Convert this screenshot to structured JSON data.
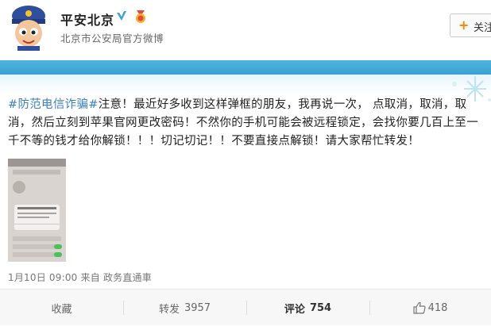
{
  "account": {
    "name": "平安北京",
    "subtitle": "北京市公安局官方微博"
  },
  "follow": {
    "plus": "+",
    "label": "关注"
  },
  "post": {
    "hashtag": "#防范电信诈骗#",
    "body": "注意！最近好多收到这样弹框的朋友，我再说一次，  点取消，取消，取消，然后立刻到苹果官网更改密码！不然你的手机可能会被远程锁定，会找你要几百上至一千不等的钱才给你解锁！！！切记切记！！不要直接点解锁！请大家帮忙转发！"
  },
  "meta": {
    "time": "1月10日 09:00",
    "source_prefix": "来自",
    "source": "政务直通車"
  },
  "actions": {
    "collect": "收藏",
    "repost_label": "转发",
    "repost_count": "3957",
    "comment_label": "评论",
    "comment_count": "754",
    "like_count": "418"
  },
  "colors": {
    "accent": "#ff8200",
    "link": "#3a7fc1",
    "banner": "#3aa3d3"
  },
  "icons": [
    "police-mascot-avatar",
    "verified-v-icon",
    "medal-icon",
    "snowflake-decoration",
    "thumbs-up-icon"
  ]
}
